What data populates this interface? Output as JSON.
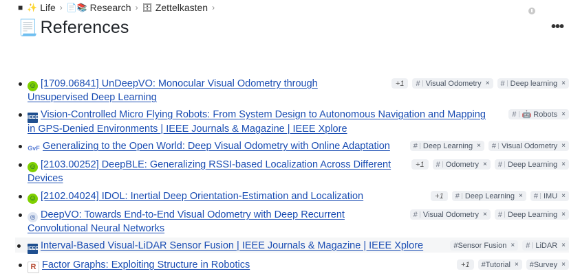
{
  "breadcrumb": [
    {
      "icon": "■",
      "label": ""
    },
    {
      "icon": "✨",
      "label": "Life"
    },
    {
      "icon": "📄📚",
      "label": "Research"
    },
    {
      "icon": "🗄",
      "label": "Zettelkasten"
    }
  ],
  "page": {
    "title_icon": "📃",
    "title": "References",
    "more_label": "•••"
  },
  "rows": [
    {
      "fav": "smile",
      "fav_text": "☺",
      "line1": "[1709.06841] UnDeepVO: Monocular Visual Odometry through",
      "line2": "Unsupervised Deep Learning",
      "tags": [
        {
          "plus": true,
          "label": "+1"
        },
        {
          "label": "Visual Odometry"
        },
        {
          "label": "Deep learning"
        }
      ]
    },
    {
      "fav": "ieee",
      "fav_text": "IEEE",
      "line1": "Vision-Controlled Micro Flying Robots: From System Design to Autonomous Navigation and Mapping",
      "line2": "in GPS-Denied Environments | IEEE Journals & Magazine | IEEE Xplore",
      "tags": [
        {
          "label": "🤖 Robots"
        }
      ]
    },
    {
      "fav": "gvf",
      "fav_text": "GvF",
      "line1": "Generalizing to the Open World: Deep Visual Odometry with Online Adaptation",
      "line2": "",
      "tags": [
        {
          "label": "Deep Learning"
        },
        {
          "label": "Visual Odometry"
        }
      ]
    },
    {
      "fav": "smile",
      "fav_text": "☺",
      "line1": "[2103.00252] DeepBLE: Generalizing RSSI-based Localization Across Different",
      "line2": "Devices",
      "tags": [
        {
          "plus": true,
          "label": "+1"
        },
        {
          "label": "Odometry"
        },
        {
          "label": "Deep Learning"
        }
      ]
    },
    {
      "fav": "smile",
      "fav_text": "☺",
      "line1": "[2102.04024] IDOL: Inertial Deep Orientation-Estimation and Localization",
      "line2": "",
      "tags": [
        {
          "plus": true,
          "label": "+1"
        },
        {
          "label": "Deep Learning"
        },
        {
          "label": "IMU"
        }
      ]
    },
    {
      "fav": "seal",
      "fav_text": "◎",
      "line1": "DeepVO: Towards End-to-End Visual Odometry with Deep Recurrent",
      "line2": "Convolutional Neural Networks",
      "tags": [
        {
          "label": "Visual Odometry"
        },
        {
          "label": "Deep Learning"
        }
      ]
    },
    {
      "fav": "ieee",
      "fav_text": "IEEE",
      "line1": "Interval-Based Visual-LiDAR Sensor Fusion | IEEE Journals & Magazine | IEEE Xplore",
      "line2": "",
      "tags": [
        {
          "label": "#Sensor Fusion",
          "raw": true
        },
        {
          "label": "LiDAR"
        }
      ]
    },
    {
      "fav": "r",
      "fav_text": "R",
      "line1": "Factor Graphs: Exploiting Structure in Robotics",
      "line2": "",
      "tags": [
        {
          "plus": true,
          "label": "+1"
        },
        {
          "label": "#Tutorial",
          "raw": true
        },
        {
          "label": "#Survey",
          "raw": true
        }
      ]
    }
  ]
}
